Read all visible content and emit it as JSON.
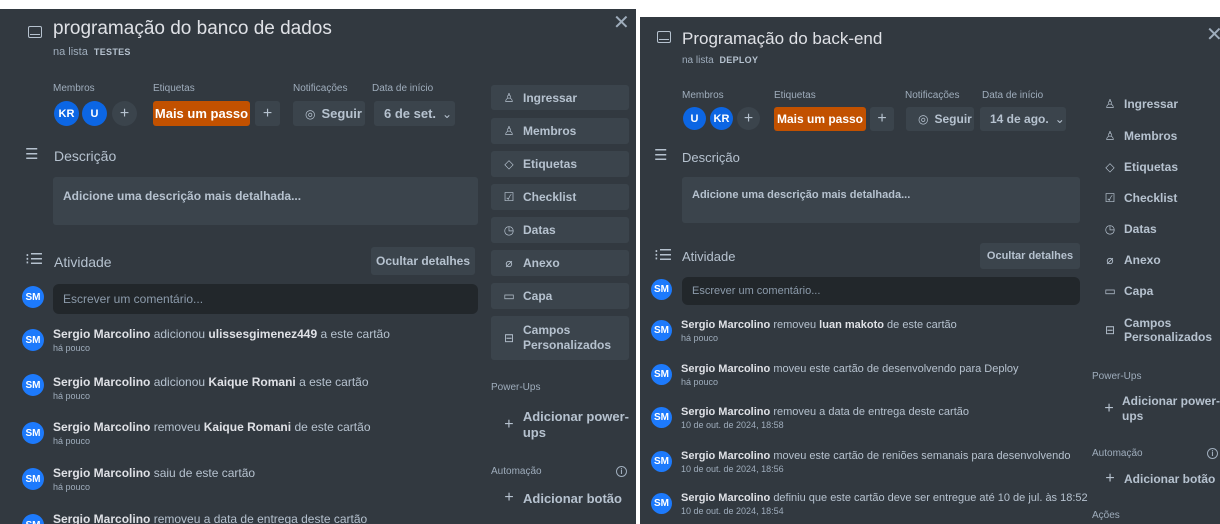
{
  "cards": [
    {
      "title": "programação do banco de dados",
      "in_list_prefix": "na lista",
      "list_name": "TESTES",
      "close_glyph": "✕",
      "members_label": "Membros",
      "members": [
        "KR",
        "U"
      ],
      "labels_label": "Etiquetas",
      "label_chip": "Mais um passo",
      "notifications_label": "Notificações",
      "follow_button": "Seguir",
      "start_date_label": "Data de início",
      "start_date_value": "6 de set.",
      "description_heading": "Descrição",
      "description_placeholder": "Adicione uma descrição mais detalhada...",
      "activity_heading": "Atividade",
      "hide_details_button": "Ocultar detalhes",
      "comment_placeholder": "Escrever um comentário...",
      "user_initials": "SM",
      "activities": [
        {
          "user": "Sergio Marcolino",
          "pre": "adicionou",
          "bold": "ulissesgimenez449",
          "post": "a este cartão",
          "time": "há pouco"
        },
        {
          "user": "Sergio Marcolino",
          "pre": "adicionou",
          "bold": "Kaique Romani",
          "post": "a este cartão",
          "time": "há pouco"
        },
        {
          "user": "Sergio Marcolino",
          "pre": "removeu",
          "bold": "Kaique Romani",
          "post": "de este cartão",
          "time": "há pouco"
        },
        {
          "user": "Sergio Marcolino",
          "pre": "saiu de este cartão",
          "bold": "",
          "post": "",
          "time": "há pouco"
        },
        {
          "user": "Sergio Marcolino",
          "pre": "removeu a data de entrega deste cartão",
          "bold": "",
          "post": "",
          "time": ""
        }
      ],
      "sidebar": {
        "join": "Ingressar",
        "members": "Membros",
        "labels": "Etiquetas",
        "checklist": "Checklist",
        "dates": "Datas",
        "attachment": "Anexo",
        "cover": "Capa",
        "custom_fields": [
          "Campos",
          "Personalizados"
        ],
        "powerups_label": "Power-Ups",
        "add_powerups": [
          "Adicionar power-",
          "ups"
        ],
        "automation_label": "Automação",
        "add_button": "Adicionar botão",
        "actions_label": ""
      }
    },
    {
      "title": "Programação do back-end",
      "in_list_prefix": "na lista",
      "list_name": "DEPLOY",
      "close_glyph": "✕",
      "members_label": "Membros",
      "members": [
        "U",
        "KR"
      ],
      "labels_label": "Etiquetas",
      "label_chip": "Mais um passo",
      "notifications_label": "Notificações",
      "follow_button": "Seguir",
      "start_date_label": "Data de início",
      "start_date_value": "14 de ago.",
      "description_heading": "Descrição",
      "description_placeholder": "Adicione uma descrição mais detalhada...",
      "activity_heading": "Atividade",
      "hide_details_button": "Ocultar detalhes",
      "comment_placeholder": "Escrever um comentário...",
      "user_initials": "SM",
      "activities": [
        {
          "user": "Sergio Marcolino",
          "pre": "removeu",
          "bold": "luan makoto",
          "post": "de este cartão",
          "time": "há pouco"
        },
        {
          "user": "Sergio Marcolino",
          "pre": "moveu este cartão de desenvolvendo para Deploy",
          "bold": "",
          "post": "",
          "time": "há pouco"
        },
        {
          "user": "Sergio Marcolino",
          "pre": "removeu a data de entrega deste cartão",
          "bold": "",
          "post": "",
          "time": "10 de out. de 2024, 18:58"
        },
        {
          "user": "Sergio Marcolino",
          "pre": "moveu este cartão de reniões semanais para desenvolvendo",
          "bold": "",
          "post": "",
          "time": "10 de out. de 2024, 18:56"
        },
        {
          "user": "Sergio Marcolino",
          "pre": "definiu que este cartão deve ser entregue até 10 de jul. às 18:52",
          "bold": "",
          "post": "",
          "time": "10 de out. de 2024, 18:54"
        }
      ],
      "sidebar": {
        "join": "Ingressar",
        "members": "Membros",
        "labels": "Etiquetas",
        "checklist": "Checklist",
        "dates": "Datas",
        "attachment": "Anexo",
        "cover": "Capa",
        "custom_fields": [
          "Campos",
          "Personalizados"
        ],
        "powerups_label": "Power-Ups",
        "add_powerups": [
          "Adicionar power-",
          "ups"
        ],
        "automation_label": "Automação",
        "add_button": "Adicionar botão",
        "actions_label": "Ações"
      }
    }
  ],
  "colors": {
    "panel_bg": "#323940",
    "button_bg": "#3b444c",
    "label_orange": "#c25100",
    "avatar_blue": "#0c66e4",
    "input_bg": "#22272b"
  },
  "icons": {
    "card": "card-icon",
    "description": "description-icon",
    "activity": "activity-icon",
    "join": "person-add-icon",
    "members": "person-icon",
    "labels": "tag-icon",
    "checklist": "checklist-icon",
    "dates": "clock-icon",
    "attachment": "paperclip-icon",
    "cover": "cover-icon",
    "custom_fields": "fields-icon",
    "add": "plus-icon",
    "eye": "eye-icon",
    "chevron": "chevron-down-icon",
    "info": "info-icon"
  }
}
